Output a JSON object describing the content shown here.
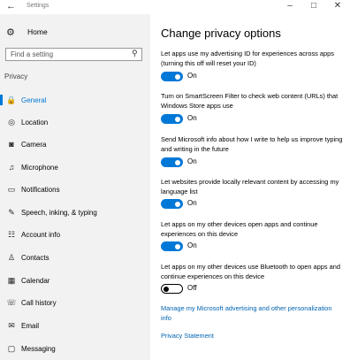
{
  "window": {
    "title": "Settings",
    "back_icon": "←",
    "minimize": "–",
    "maximize": "□",
    "close": "✕"
  },
  "sidebar": {
    "home": {
      "label": "Home",
      "icon": "gear-icon"
    },
    "search_placeholder": "Find a setting",
    "section": "Privacy",
    "items": [
      {
        "label": "General",
        "icon": "lock-icon",
        "active": true
      },
      {
        "label": "Location",
        "icon": "location-icon"
      },
      {
        "label": "Camera",
        "icon": "camera-icon"
      },
      {
        "label": "Microphone",
        "icon": "microphone-icon"
      },
      {
        "label": "Notifications",
        "icon": "notifications-icon"
      },
      {
        "label": "Speech, inking, & typing",
        "icon": "speech-icon"
      },
      {
        "label": "Account info",
        "icon": "account-icon"
      },
      {
        "label": "Contacts",
        "icon": "contacts-icon"
      },
      {
        "label": "Calendar",
        "icon": "calendar-icon"
      },
      {
        "label": "Call history",
        "icon": "call-history-icon"
      },
      {
        "label": "Email",
        "icon": "email-icon"
      },
      {
        "label": "Messaging",
        "icon": "messaging-icon"
      }
    ]
  },
  "main": {
    "title": "Change privacy options",
    "settings": [
      {
        "description": "Let apps use my advertising ID for experiences across apps (turning this off will reset your ID)",
        "state": "On"
      },
      {
        "description": "Turn on SmartScreen Filter to check web content (URLs) that Windows Store apps use",
        "state": "On"
      },
      {
        "description": "Send Microsoft info about how I write to help us improve typing and writing in the future",
        "state": "On"
      },
      {
        "description": "Let websites provide locally relevant content by accessing my language list",
        "state": "On"
      },
      {
        "description": "Let apps on my other devices open apps and continue experiences on this device",
        "state": "On"
      },
      {
        "description": "Let apps on my other devices use Bluetooth to open apps and continue experiences on this device",
        "state": "Off"
      }
    ],
    "links": [
      "Manage my Microsoft advertising and other personalization info",
      "Privacy Statement"
    ]
  },
  "colors": {
    "accent": "#0078d7",
    "link": "#0063b1",
    "sidebar_bg": "#f2f2f2"
  }
}
